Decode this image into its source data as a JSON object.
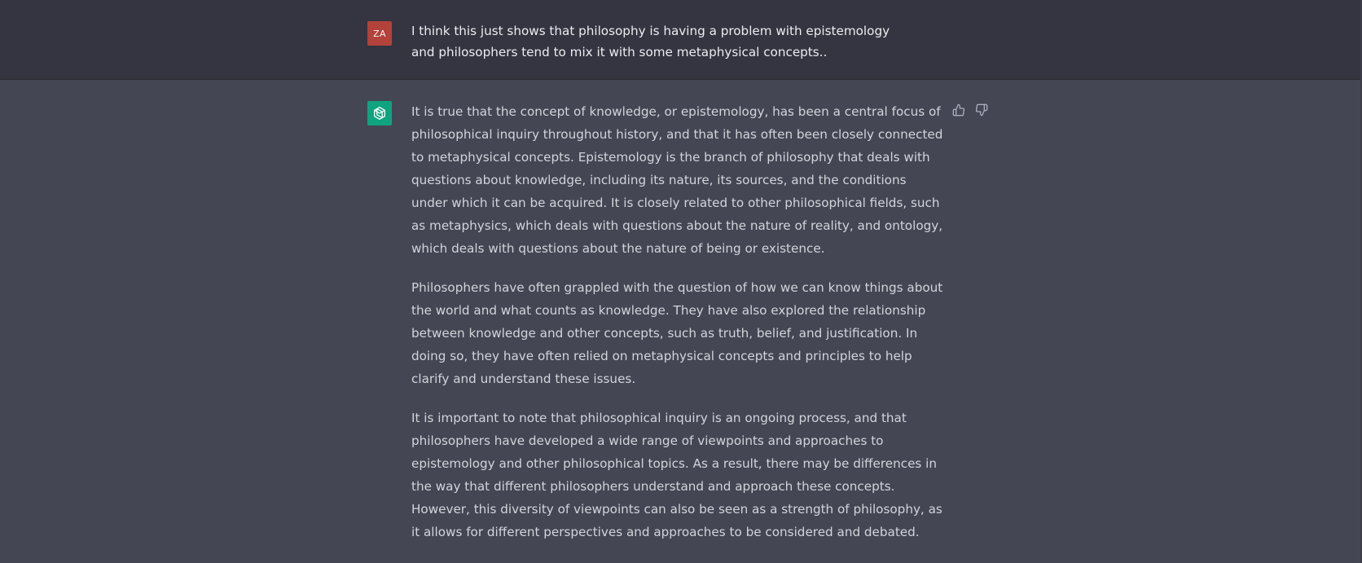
{
  "conversation": {
    "user_message": {
      "avatar_initials": "ZA",
      "avatar_color": "#b3423a",
      "text": "I think this just shows that philosophy is having a problem with epistemology and philosophers tend to mix it with some metaphysical concepts.."
    },
    "assistant_message": {
      "avatar_icon": "openai-logo-icon",
      "avatar_color": "#10a37f",
      "paragraphs": [
        "It is true that the concept of knowledge, or epistemology, has been a central focus of philosophical inquiry throughout history, and that it has often been closely connected to metaphysical concepts. Epistemology is the branch of philosophy that deals with questions about knowledge, including its nature, its sources, and the conditions under which it can be acquired. It is closely related to other philosophical fields, such as metaphysics, which deals with questions about the nature of reality, and ontology, which deals with questions about the nature of being or existence.",
        "Philosophers have often grappled with the question of how we can know things about the world and what counts as knowledge. They have also explored the relationship between knowledge and other concepts, such as truth, belief, and justification. In doing so, they have often relied on metaphysical concepts and principles to help clarify and understand these issues.",
        "It is important to note that philosophical inquiry is an ongoing process, and that philosophers have developed a wide range of viewpoints and approaches to epistemology and other philosophical topics. As a result, there may be differences in the way that different philosophers understand and approach these concepts. However, this diversity of viewpoints can also be seen as a strength of philosophy, as it allows for different perspectives and approaches to be considered and debated."
      ],
      "feedback_icons": [
        "thumbs-up-icon",
        "thumbs-down-icon"
      ]
    }
  },
  "colors": {
    "user_row_bg": "#343541",
    "assistant_row_bg": "#444654",
    "text_primary": "#ececf1",
    "text_secondary": "#d1d5db"
  }
}
